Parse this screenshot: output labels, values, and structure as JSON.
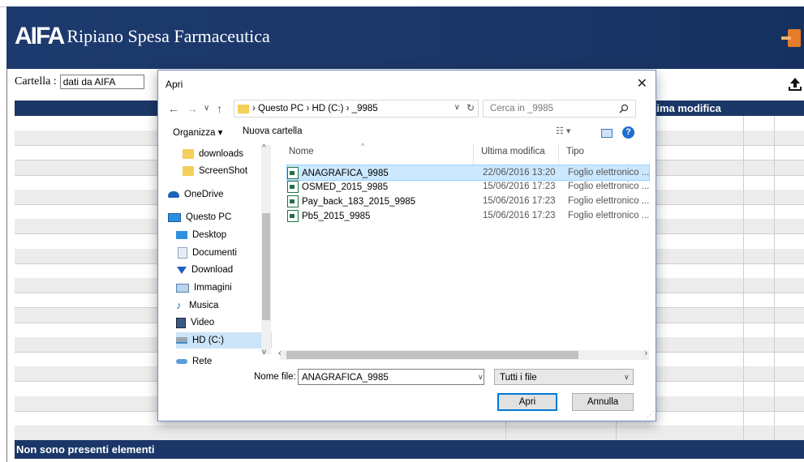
{
  "app": {
    "logo": "AIFA",
    "title": "Ripiano Spesa Farmaceutica"
  },
  "folder": {
    "label": "Cartella :",
    "value": "dati da AIFA"
  },
  "table": {
    "header_last_modified": "Ultima modifica",
    "empty_message": "Non sono presenti elementi"
  },
  "dialog": {
    "title": "Apri",
    "close": "✕",
    "nav": {
      "back": "←",
      "forward": "→",
      "recent": "∨",
      "up": "↑"
    },
    "path": "›  Questo PC  ›  HD (C:)  ›  _9985",
    "path_dropdown": "∨",
    "refresh": "↻",
    "search_placeholder": "Cerca in _9985",
    "toolbar": {
      "organize": "Organizza ▾",
      "new_folder": "Nuova cartella",
      "view": "☷ ▾",
      "help": "?"
    },
    "nav_pane": [
      {
        "label": "downloads",
        "icon": "folder-icon"
      },
      {
        "label": "ScreenShot",
        "icon": "folder-icon"
      },
      {
        "label": "OneDrive",
        "icon": "cloud-icon"
      },
      {
        "label": "Questo PC",
        "icon": "pc-icon"
      },
      {
        "label": "Desktop",
        "icon": "desktop-icon"
      },
      {
        "label": "Documenti",
        "icon": "documents-icon"
      },
      {
        "label": "Download",
        "icon": "download-icon"
      },
      {
        "label": "Immagini",
        "icon": "pictures-icon"
      },
      {
        "label": "Musica",
        "icon": "music-icon"
      },
      {
        "label": "Video",
        "icon": "video-icon"
      },
      {
        "label": "HD (C:)",
        "icon": "drive-icon"
      },
      {
        "label": "Rete",
        "icon": "network-icon"
      }
    ],
    "columns": {
      "name": "Nome",
      "modified": "Ultima modifica",
      "type": "Tipo"
    },
    "files": [
      {
        "name": "ANAGRAFICA_9985",
        "modified": "22/06/2016 13:20",
        "type": "Foglio elettronico ...",
        "selected": true
      },
      {
        "name": "OSMED_2015_9985",
        "modified": "15/06/2016 17:23",
        "type": "Foglio elettronico ...",
        "selected": false
      },
      {
        "name": "Pay_back_183_2015_9985",
        "modified": "15/06/2016 17:23",
        "type": "Foglio elettronico ...",
        "selected": false
      },
      {
        "name": "Pb5_2015_9985",
        "modified": "15/06/2016 17:23",
        "type": "Foglio elettronico ...",
        "selected": false
      }
    ],
    "filename_label": "Nome file:",
    "filename_value": "ANAGRAFICA_9985",
    "filter_value": "Tutti i file",
    "open_button": "Apri",
    "cancel_button": "Annulla"
  }
}
